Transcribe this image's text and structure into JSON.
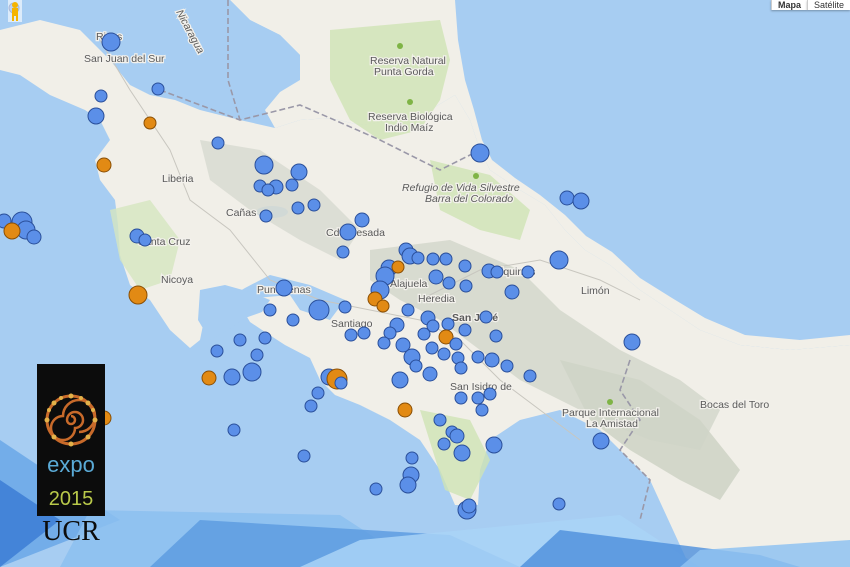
{
  "map": {
    "labels": {
      "san_juan_del_sur": "San Juan del Sur",
      "rivas": "Rivas",
      "nicaragua": "Nicaragua",
      "liberia": "Liberia",
      "canas": "Cañas",
      "santa_cruz": "Santa Cruz",
      "nicoya": "Nicoya",
      "puntarenas": "Puntarenas",
      "santiago": "Santiago",
      "heredia": "Heredia",
      "alajuela": "Alajuela",
      "san_jose": "San José",
      "ciudad_quesada": "Cd Quesada",
      "siquirres": "Siquirres",
      "limon": "Limón",
      "san_isidro": "San Isidro de",
      "bocas_del_toro": "Bocas del Toro",
      "reserva_punta_gorda_1": "Reserva Natural",
      "reserva_punta_gorda_2": "Punta Gorda",
      "reserva_indio_maiz_1": "Reserva Biológica",
      "reserva_indio_maiz_2": "Indio Maíz",
      "refugio_1": "Refugio de Vida Silvestre",
      "refugio_2": "Barra del Colorado",
      "parque_1": "Parque Internacional",
      "parque_2": "La Amistad"
    },
    "colors": {
      "ocean": "#a7cdf2",
      "land": "#f1efe8",
      "forest": "#cfe3b4",
      "mountain": "#dbdcd3",
      "blue_marker": "#5b8fe8",
      "orange_marker": "#e28a14",
      "marker_stroke": "#2a4f9a"
    }
  },
  "map_type": {
    "map_label": "Mapa",
    "satellite_label": "Satélite"
  },
  "logo": {
    "expo": "expo",
    "year": "2015",
    "ucr": "UCR"
  }
}
